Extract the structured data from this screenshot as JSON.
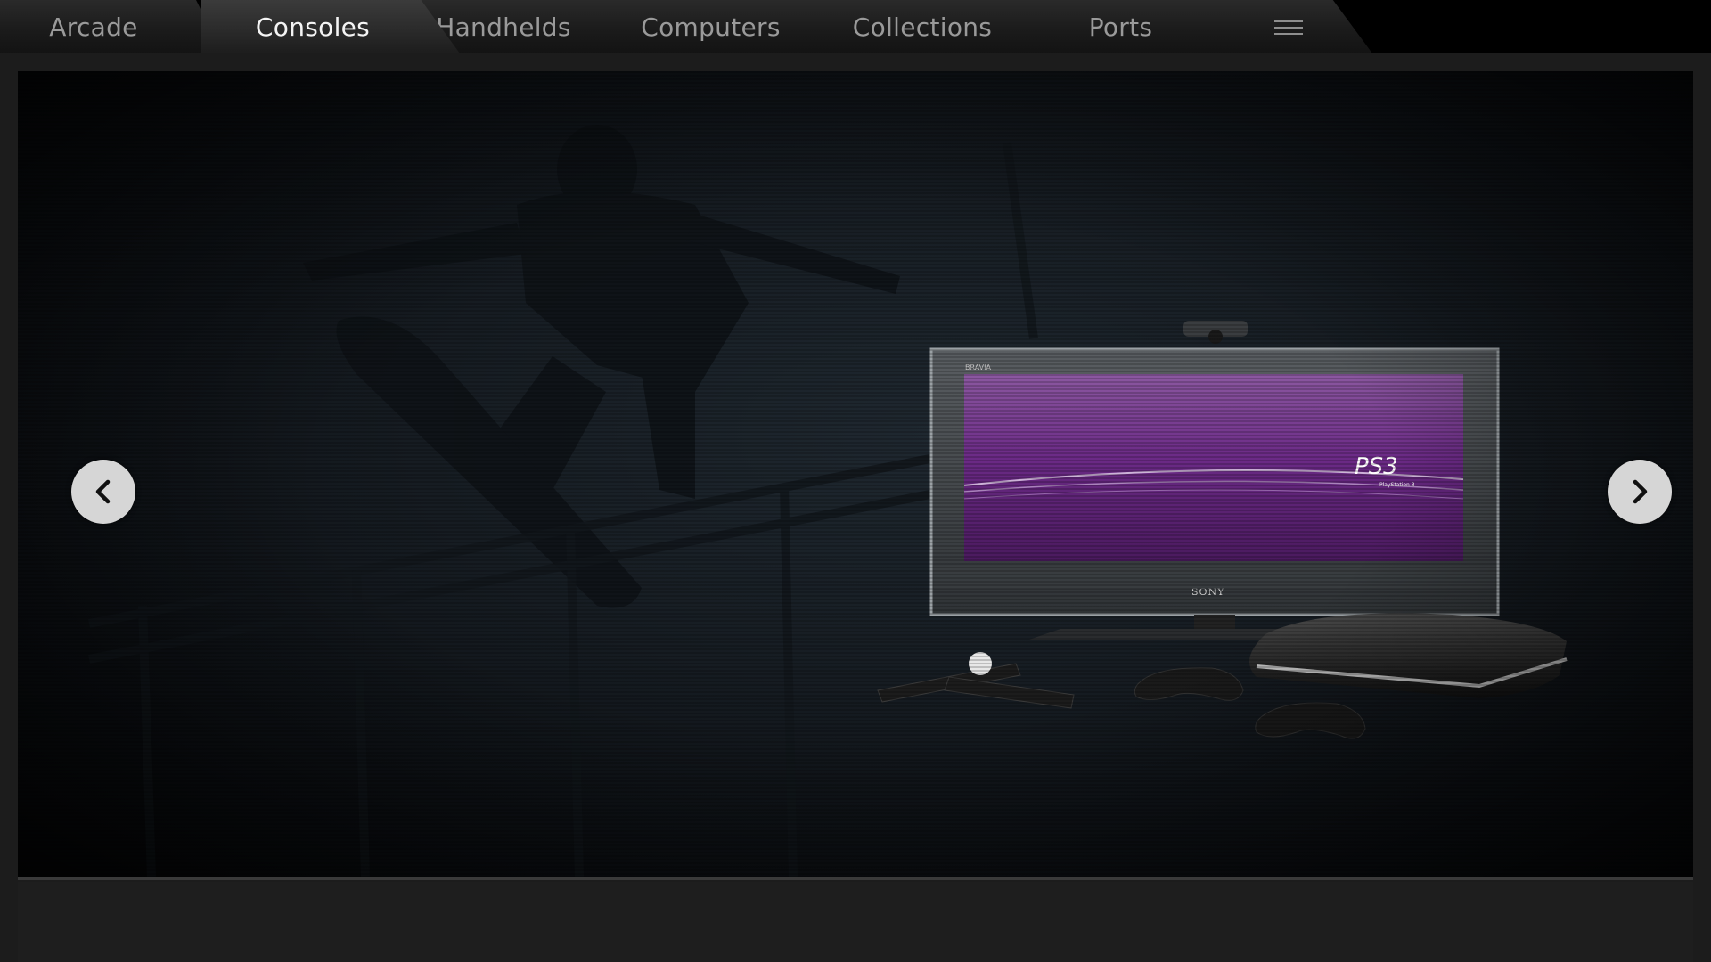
{
  "tabs": [
    {
      "label": "Arcade",
      "active": false
    },
    {
      "label": "Consoles",
      "active": true
    },
    {
      "label": "Handhelds",
      "active": false
    },
    {
      "label": "Computers",
      "active": false
    },
    {
      "label": "Collections",
      "active": false
    },
    {
      "label": "Ports",
      "active": false
    }
  ],
  "menu": {
    "icon": "hamburger-menu-icon"
  },
  "preview": {
    "tv_brand_top": "BRAVIA",
    "tv_brand_bottom": "SONY",
    "screen_logo": "PS3",
    "screen_logo_sub": "PlayStation 3"
  },
  "navigation": {
    "prev_icon": "chevron-left-icon",
    "next_icon": "chevron-right-icon"
  },
  "colors": {
    "tab_active_text": "#f4f4f4",
    "tab_text": "#9a9a9a",
    "screen_purple": "#6b2a86",
    "arrow_bg": "#d6d6d6"
  }
}
